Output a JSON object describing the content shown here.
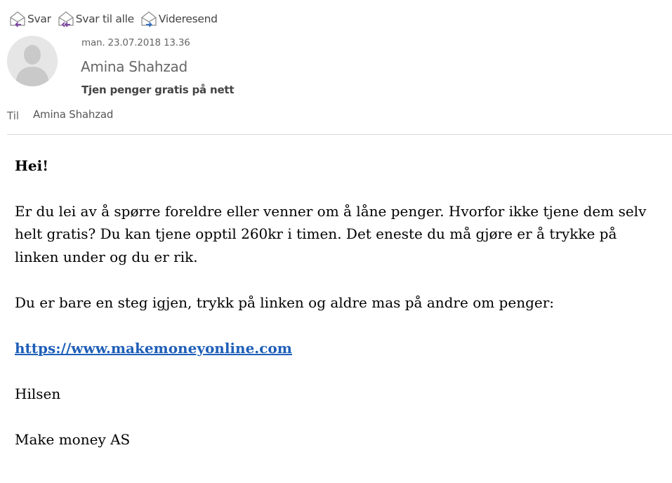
{
  "toolbar": {
    "reply_label": "Svar",
    "reply_all_label": "Svar til alle",
    "forward_label": "Videresend"
  },
  "header": {
    "date": "man. 23.07.2018 13.36",
    "sender": "Amina Shahzad",
    "subject": "Tjen penger gratis på nett",
    "to_label": "Til",
    "to_name": "Amina Shahzad"
  },
  "body": {
    "greeting": "Hei!",
    "paragraph1": "Er du lei av å spørre foreldre eller venner om å låne penger. Hvorfor ikke tjene dem selv helt gratis? Du kan tjene opptil 260kr i timen. Det eneste du må gjøre er å trykke på linken under og du er rik.",
    "paragraph2": "Du er bare en steg igjen, trykk på linken og aldre mas på andre om penger:",
    "link": "https://www.makemoneyonline.com",
    "closing": "Hilsen",
    "signature": "Make money AS"
  },
  "colors": {
    "link": "#1f5fb8",
    "reply_arrow": "#7a3fa0",
    "forward_arrow": "#2a6cc0",
    "divider": "#dadada"
  },
  "icons": {
    "reply": "envelope-reply-icon",
    "reply_all": "envelope-reply-all-icon",
    "forward": "envelope-forward-icon",
    "avatar": "person-placeholder-icon"
  }
}
